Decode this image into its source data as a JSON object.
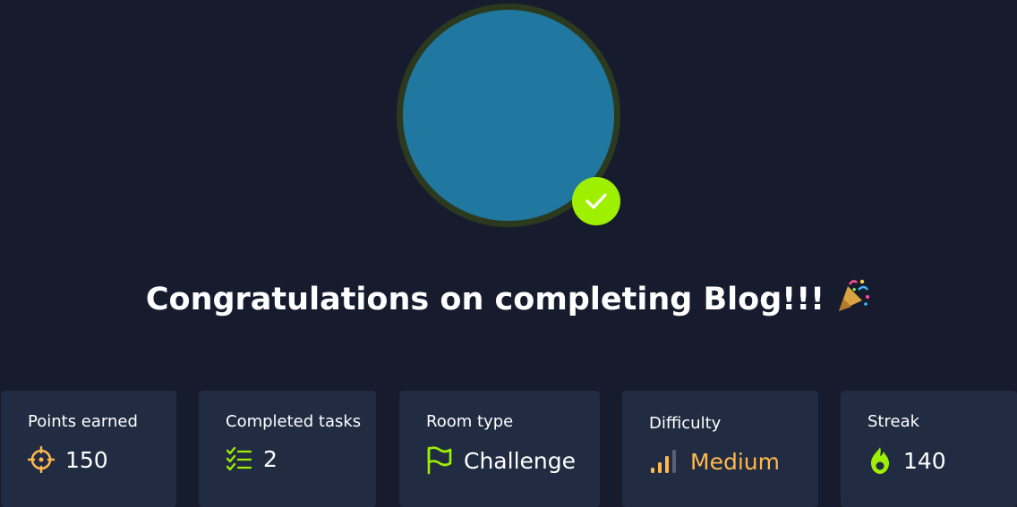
{
  "title": "Congratulations on completing Blog!!!",
  "colors": {
    "background": "#161c2d",
    "card": "#212c42",
    "avatar": "#2077a0",
    "accent_green": "#9fef00",
    "accent_orange": "#ffb84e"
  },
  "stats": [
    {
      "label": "Points earned",
      "value": "150",
      "icon": "target-icon"
    },
    {
      "label": "Completed tasks",
      "value": "2",
      "icon": "task-list-icon"
    },
    {
      "label": "Room type",
      "value": "Challenge",
      "icon": "flag-icon"
    },
    {
      "label": "Difficulty",
      "value": "Medium",
      "icon": "signal-bars-icon"
    },
    {
      "label": "Streak",
      "value": "140",
      "icon": "flame-icon"
    }
  ]
}
